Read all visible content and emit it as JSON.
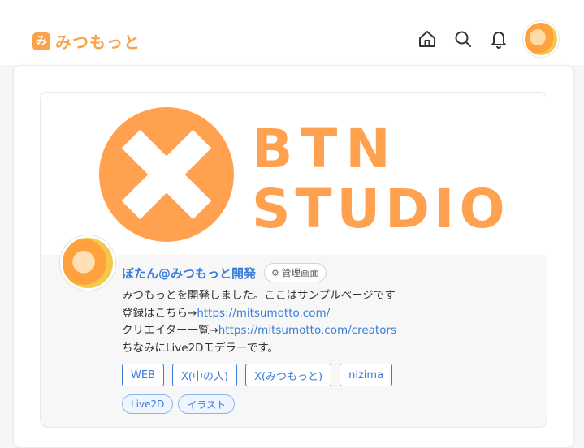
{
  "brand": {
    "badge": "み",
    "name": "みつもっと"
  },
  "header_icons": [
    "home-icon",
    "search-icon",
    "bell-icon",
    "avatar"
  ],
  "banner": {
    "logo_line1": "BTN",
    "logo_line2": "STUDIO",
    "accent_color": "#ffa14f"
  },
  "profile": {
    "name": "ぼたん@みつもっと開発",
    "admin_label": "管理画面",
    "bio_line1": "みつもっとを開発しました。ここはサンプルページです",
    "bio_line2_prefix": "登録はこちら→",
    "bio_line2_link": "https://mitsumotto.com/",
    "bio_line3_prefix": "クリエイター一覧→",
    "bio_line3_link": "https://mitsumotto.com/creators",
    "bio_line4": "ちなみにLive2Dモデラーです。"
  },
  "links": [
    "WEB",
    "X(中の人)",
    "X(みつもっと)",
    "nizima"
  ],
  "tags": [
    "Live2D",
    "イラスト"
  ],
  "colors": {
    "brand": "#f9a24a",
    "link": "#3b7dd8"
  }
}
